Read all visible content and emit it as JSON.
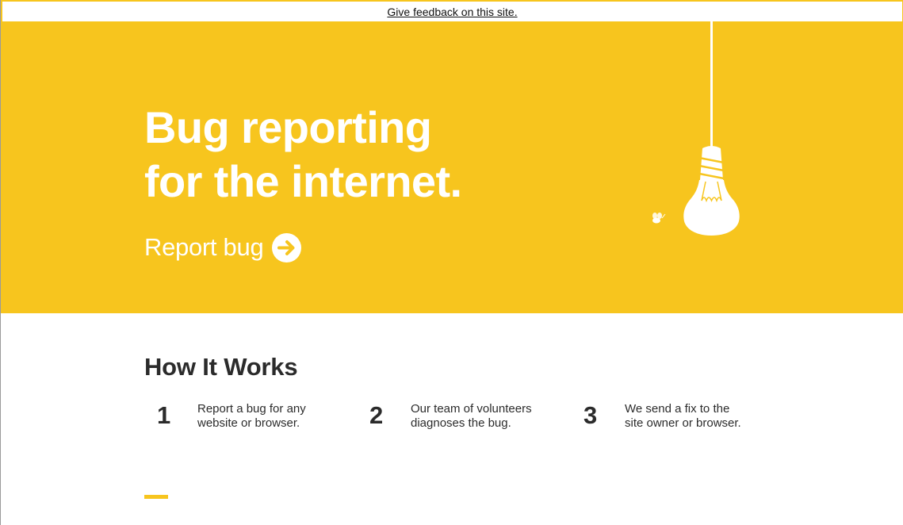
{
  "feedback_bar": {
    "link": "Give feedback on this site."
  },
  "hero": {
    "title_line_1": "Bug reporting",
    "title_line_2": "for the internet.",
    "report_label": "Report bug",
    "arrow_icon": "arrow-right-circle-icon",
    "illustration_icon": "light-bulb-icon",
    "bug_icon": "bee-icon"
  },
  "how_it_works": {
    "heading": "How It Works",
    "steps": [
      {
        "number": "1",
        "text": "Report a bug for any\nwebsite or browser."
      },
      {
        "number": "2",
        "text": "Our team of volunteers\ndiagnoses the bug."
      },
      {
        "number": "3",
        "text": "We send a fix to the\nsite owner or browser."
      }
    ]
  },
  "colors": {
    "brand_yellow": "#f7c51e",
    "text_dark": "#2b2b2b",
    "white": "#ffffff"
  }
}
